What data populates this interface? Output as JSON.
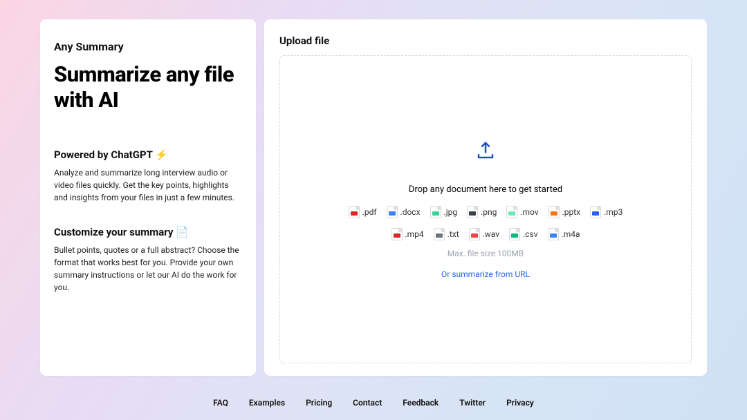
{
  "brand": "Any Summary",
  "headline": "Summarize any file with AI",
  "features": [
    {
      "title": "Powered by ChatGPT ⚡",
      "body": "Analyze and summarize long interview audio or video files quickly. Get the key points, highlights and insights from your files in just a few minutes."
    },
    {
      "title": "Customize your summary 📄",
      "body": "Bullet points, quotes or a full abstract? Choose the format that works best for you. Provide your own summary instructions or let our AI do the work for you."
    }
  ],
  "upload": {
    "title": "Upload file",
    "drop_text": "Drop any document here to get started",
    "max_size": "Max. file size 100MB",
    "url_link": "Or summarize from URL",
    "types": [
      {
        "ext": ".pdf",
        "color": "#e02424"
      },
      {
        "ext": ".docx",
        "color": "#3b82f6"
      },
      {
        "ext": ".jpg",
        "color": "#34d399"
      },
      {
        "ext": ".png",
        "color": "#374151"
      },
      {
        "ext": ".mov",
        "color": "#6ee7b7"
      },
      {
        "ext": ".pptx",
        "color": "#f97316"
      },
      {
        "ext": ".mp3",
        "color": "#2563eb"
      },
      {
        "ext": ".mp4",
        "color": "#dc2626"
      },
      {
        "ext": ".txt",
        "color": "#6b7280"
      },
      {
        "ext": ".wav",
        "color": "#ef4444"
      },
      {
        "ext": ".csv",
        "color": "#10b981"
      },
      {
        "ext": ".m4a",
        "color": "#3b82f6"
      }
    ]
  },
  "footer": [
    "FAQ",
    "Examples",
    "Pricing",
    "Contact",
    "Feedback",
    "Twitter",
    "Privacy"
  ]
}
